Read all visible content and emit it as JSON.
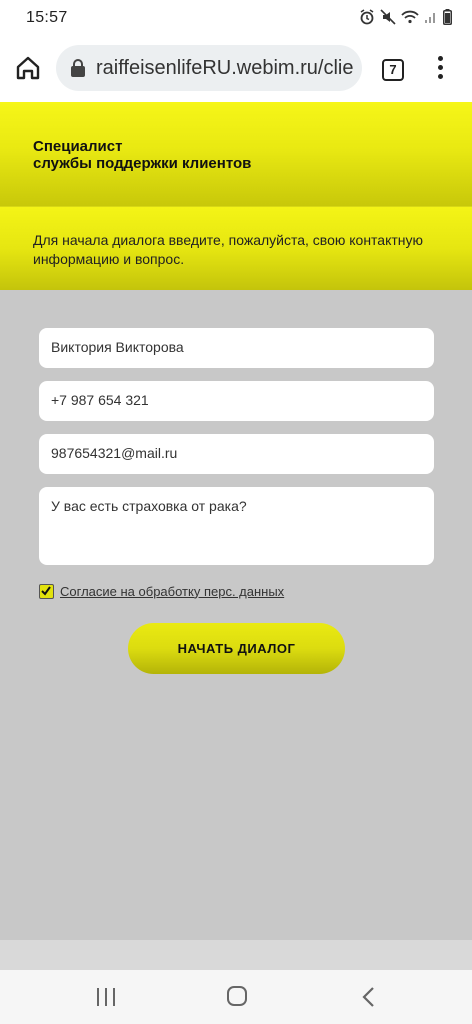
{
  "status": {
    "time": "15:57",
    "icons": [
      "alarm-icon",
      "mute-icon",
      "wifi-icon",
      "signal-icon",
      "battery-icon"
    ]
  },
  "browser": {
    "url": "raiffeisenlifeRU.webim.ru/clie",
    "tab_count": "7"
  },
  "chat": {
    "header_line1": "Специалист",
    "header_line2": "службы поддержки клиентов",
    "intro": "Для начала диалога введите, пожалуйста, свою контактную информацию и вопрос."
  },
  "form": {
    "name_value": "Виктория Викторова",
    "phone_value": "+7 987 654 321",
    "email_value": "987654321@mail.ru",
    "question_value": "У вас есть страховка от рака?",
    "consent_label": "Согласие на обработку перс. данных",
    "consent_checked": true,
    "start_button": "НАЧАТЬ ДИАЛОГ"
  },
  "colors": {
    "accent_yellow": "#e6e611",
    "form_bg": "#c8c8c8"
  }
}
